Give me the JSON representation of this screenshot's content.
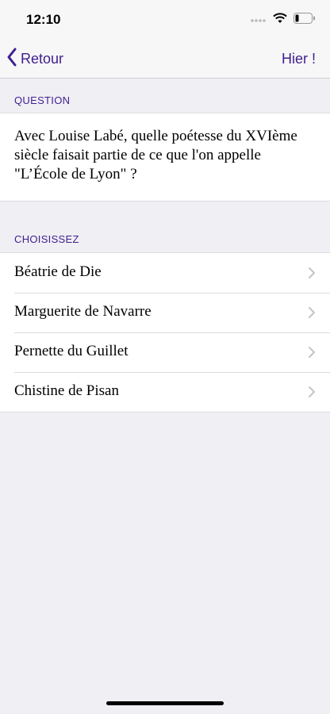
{
  "status_bar": {
    "time": "12:10"
  },
  "nav": {
    "back_label": "Retour",
    "right_label": "Hier !"
  },
  "question_section": {
    "header": "QUESTION",
    "text": "Avec Louise Labé, quelle poétesse du XVIème siècle faisait partie de ce que l'on appelle \"L’École de Lyon\" ?"
  },
  "choices_section": {
    "header": "CHOISISSEZ",
    "items": [
      {
        "label": "Béatrie de Die"
      },
      {
        "label": "Marguerite de Navarre"
      },
      {
        "label": "Pernette du Guillet"
      },
      {
        "label": "Chistine de Pisan"
      }
    ]
  },
  "colors": {
    "accent": "#3f1f8f",
    "background": "#efeff4"
  },
  "icons": [
    "cellular-signal-icon",
    "wifi-icon",
    "battery-icon",
    "chevron-left-icon",
    "chevron-right-icon"
  ]
}
